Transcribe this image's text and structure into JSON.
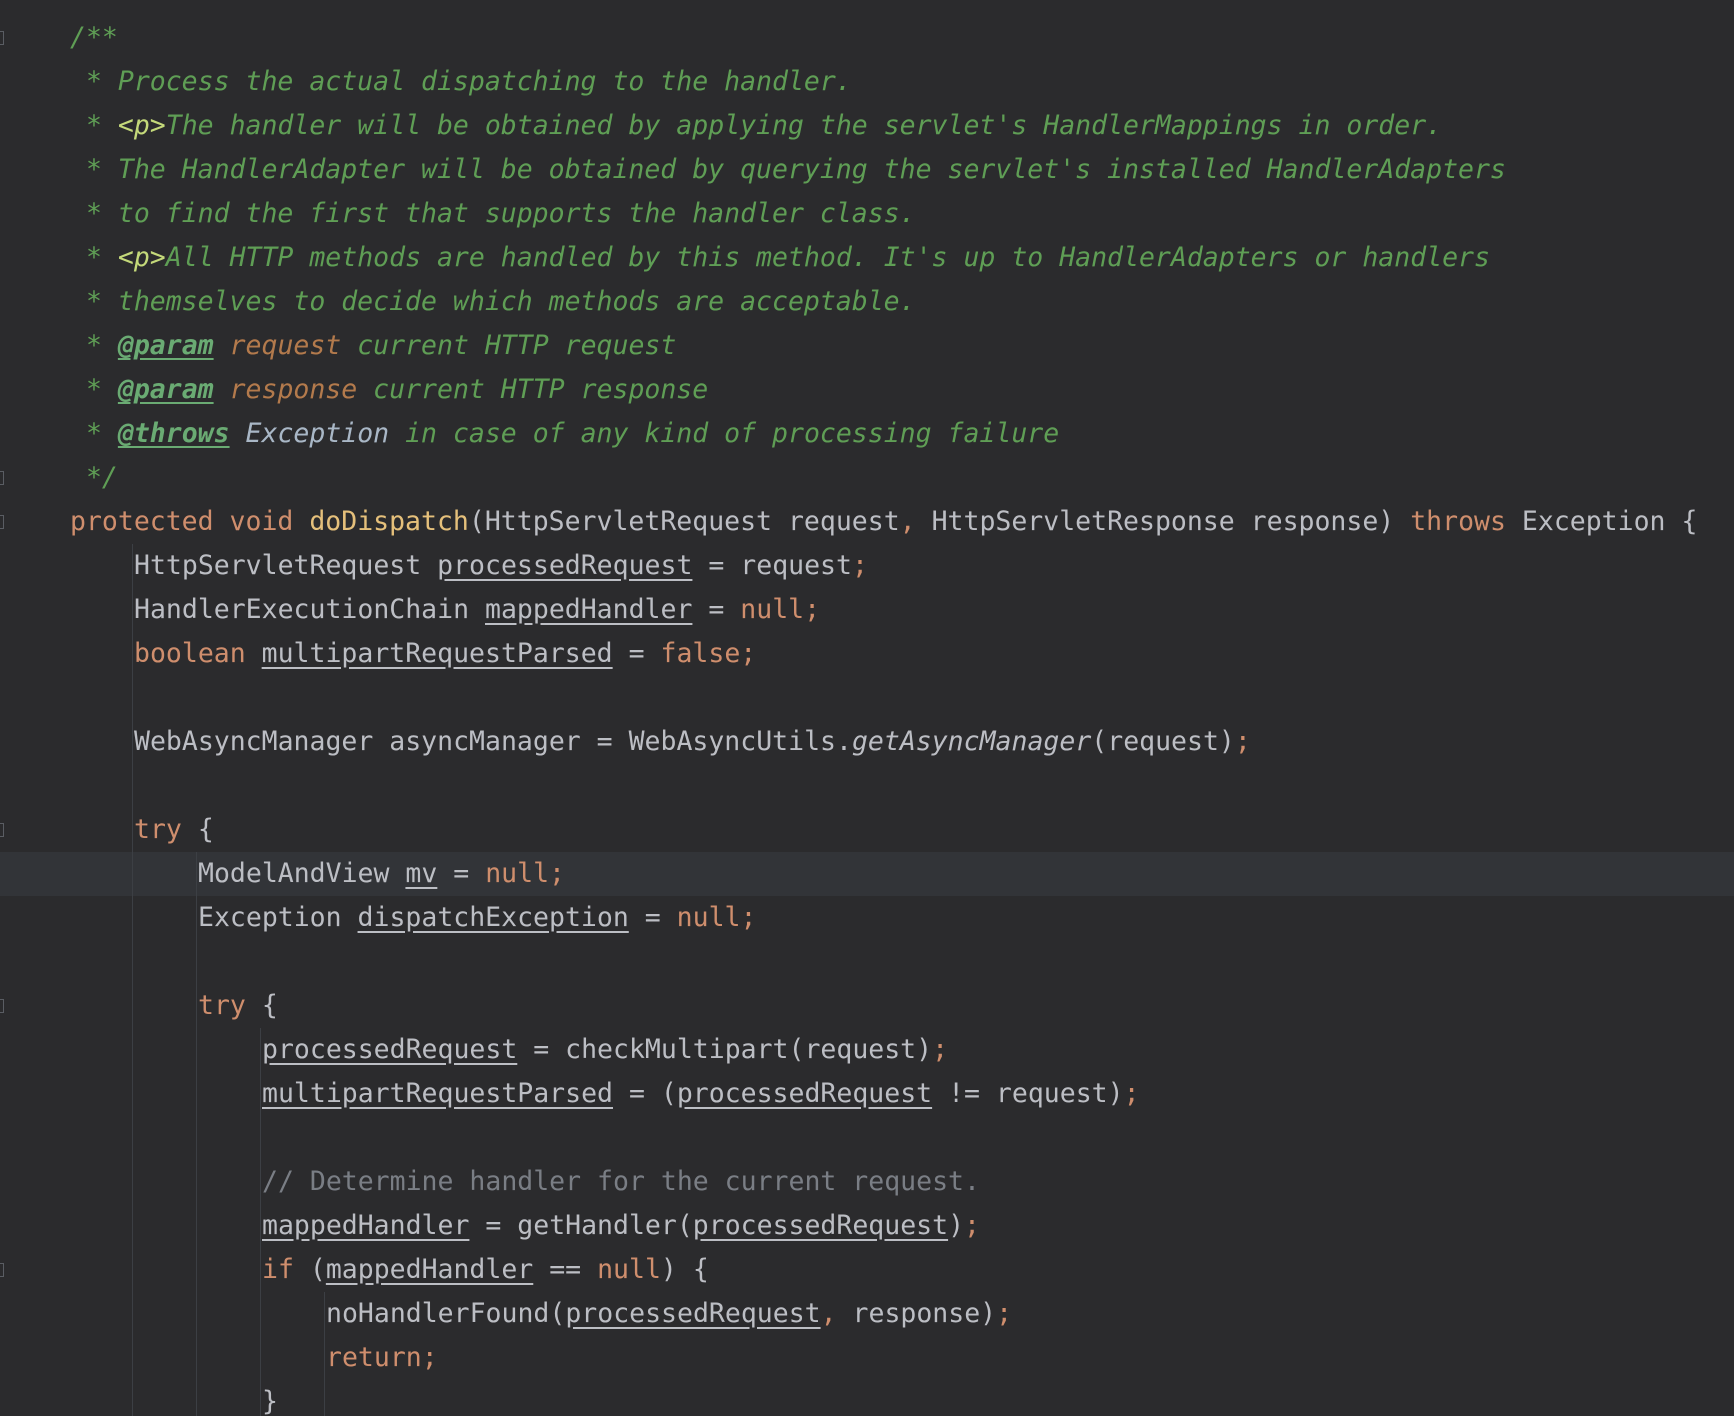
{
  "editor": {
    "language": "Java",
    "caret_line_index": 19,
    "colors": {
      "background": "#2b2b2d",
      "comment": "#5f9e55",
      "keyword": "#cf8e6d",
      "method_declaration": "#e5c07b",
      "identifier": "#bcbec4",
      "line_comment": "#7a7e85",
      "caret_row": "#323438"
    },
    "lines": [
      {
        "indent": 0,
        "tokens": [
          {
            "t": "/**",
            "c": "cm"
          }
        ]
      },
      {
        "indent": 0,
        "tokens": [
          {
            "t": " * Process the actual dispatching to the handler.",
            "c": "cm"
          }
        ]
      },
      {
        "indent": 0,
        "tokens": [
          {
            "t": " * ",
            "c": "cm"
          },
          {
            "t": "<p>",
            "c": "tag"
          },
          {
            "t": "The handler will be obtained by applying the servlet's HandlerMappings in order.",
            "c": "cm"
          }
        ]
      },
      {
        "indent": 0,
        "tokens": [
          {
            "t": " * The HandlerAdapter will be obtained by querying the servlet's installed HandlerAdapters",
            "c": "cm"
          }
        ]
      },
      {
        "indent": 0,
        "tokens": [
          {
            "t": " * to find the first that supports the handler class.",
            "c": "cm"
          }
        ]
      },
      {
        "indent": 0,
        "tokens": [
          {
            "t": " * ",
            "c": "cm"
          },
          {
            "t": "<p>",
            "c": "tag"
          },
          {
            "t": "All HTTP methods are handled by this method. It's up to HandlerAdapters or handlers",
            "c": "cm"
          }
        ]
      },
      {
        "indent": 0,
        "tokens": [
          {
            "t": " * themselves to decide which methods are acceptable.",
            "c": "cm"
          }
        ]
      },
      {
        "indent": 0,
        "tokens": [
          {
            "t": " * ",
            "c": "cm"
          },
          {
            "t": "@param",
            "c": "jtag"
          },
          {
            "t": " ",
            "c": "cm"
          },
          {
            "t": "request",
            "c": "prm"
          },
          {
            "t": " current HTTP request",
            "c": "cm"
          }
        ]
      },
      {
        "indent": 0,
        "tokens": [
          {
            "t": " * ",
            "c": "cm"
          },
          {
            "t": "@param",
            "c": "jtag"
          },
          {
            "t": " ",
            "c": "cm"
          },
          {
            "t": "response",
            "c": "prm"
          },
          {
            "t": " current HTTP response",
            "c": "cm"
          }
        ]
      },
      {
        "indent": 0,
        "tokens": [
          {
            "t": " * ",
            "c": "cm"
          },
          {
            "t": "@throws",
            "c": "jtag"
          },
          {
            "t": " ",
            "c": "cm"
          },
          {
            "t": "Exception",
            "c": "ref"
          },
          {
            "t": " in case of any kind of processing failure",
            "c": "cm"
          }
        ]
      },
      {
        "indent": 0,
        "tokens": [
          {
            "t": " */",
            "c": "cm"
          }
        ]
      },
      {
        "indent": 0,
        "tokens": [
          {
            "t": "protected void ",
            "c": "kw"
          },
          {
            "t": "doDispatch",
            "c": "fn"
          },
          {
            "t": "(HttpServletRequest request",
            "c": "id"
          },
          {
            "t": ", ",
            "c": "punc"
          },
          {
            "t": "HttpServletResponse response) ",
            "c": "id"
          },
          {
            "t": "throws ",
            "c": "kw"
          },
          {
            "t": "Exception {",
            "c": "id"
          }
        ]
      },
      {
        "indent": 1,
        "tokens": [
          {
            "t": "HttpServletRequest ",
            "c": "id"
          },
          {
            "t": "processedRequest",
            "c": "var"
          },
          {
            "t": " = request",
            "c": "id"
          },
          {
            "t": ";",
            "c": "punc"
          }
        ]
      },
      {
        "indent": 1,
        "tokens": [
          {
            "t": "HandlerExecutionChain ",
            "c": "id"
          },
          {
            "t": "mappedHandler",
            "c": "var"
          },
          {
            "t": " = ",
            "c": "id"
          },
          {
            "t": "null;",
            "c": "kw"
          }
        ]
      },
      {
        "indent": 1,
        "tokens": [
          {
            "t": "boolean ",
            "c": "kw"
          },
          {
            "t": "multipartRequestParsed",
            "c": "var"
          },
          {
            "t": " = ",
            "c": "id"
          },
          {
            "t": "false;",
            "c": "kw"
          }
        ]
      },
      {
        "indent": 1,
        "tokens": []
      },
      {
        "indent": 1,
        "tokens": [
          {
            "t": "WebAsyncManager asyncManager = WebAsyncUtils.",
            "c": "id"
          },
          {
            "t": "getAsyncManager",
            "c": "it"
          },
          {
            "t": "(request)",
            "c": "id"
          },
          {
            "t": ";",
            "c": "punc"
          }
        ]
      },
      {
        "indent": 1,
        "tokens": []
      },
      {
        "indent": 1,
        "tokens": [
          {
            "t": "try ",
            "c": "kw"
          },
          {
            "t": "{",
            "c": "id"
          }
        ]
      },
      {
        "indent": 2,
        "tokens": [
          {
            "t": "ModelAndView ",
            "c": "id"
          },
          {
            "t": "mv",
            "c": "var"
          },
          {
            "t": " = ",
            "c": "id"
          },
          {
            "t": "null;",
            "c": "kw"
          }
        ]
      },
      {
        "indent": 2,
        "tokens": [
          {
            "t": "Exception ",
            "c": "id"
          },
          {
            "t": "dispatchException",
            "c": "var"
          },
          {
            "t": " = ",
            "c": "id"
          },
          {
            "t": "null;",
            "c": "kw"
          }
        ]
      },
      {
        "indent": 2,
        "tokens": []
      },
      {
        "indent": 2,
        "tokens": [
          {
            "t": "try ",
            "c": "kw"
          },
          {
            "t": "{",
            "c": "id"
          }
        ]
      },
      {
        "indent": 3,
        "tokens": [
          {
            "t": "processedRequest",
            "c": "var"
          },
          {
            "t": " = checkMultipart(request)",
            "c": "id"
          },
          {
            "t": ";",
            "c": "punc"
          }
        ]
      },
      {
        "indent": 3,
        "tokens": [
          {
            "t": "multipartRequestParsed",
            "c": "var"
          },
          {
            "t": " = (",
            "c": "id"
          },
          {
            "t": "processedRequest",
            "c": "var"
          },
          {
            "t": " != request)",
            "c": "id"
          },
          {
            "t": ";",
            "c": "punc"
          }
        ]
      },
      {
        "indent": 3,
        "tokens": []
      },
      {
        "indent": 3,
        "tokens": [
          {
            "t": "// Determine handler for the current request.",
            "c": "lc"
          }
        ]
      },
      {
        "indent": 3,
        "tokens": [
          {
            "t": "mappedHandler",
            "c": "var"
          },
          {
            "t": " = getHandler(",
            "c": "id"
          },
          {
            "t": "processedRequest",
            "c": "var"
          },
          {
            "t": ")",
            "c": "id"
          },
          {
            "t": ";",
            "c": "punc"
          }
        ]
      },
      {
        "indent": 3,
        "tokens": [
          {
            "t": "if ",
            "c": "kw"
          },
          {
            "t": "(",
            "c": "id"
          },
          {
            "t": "mappedHandler",
            "c": "var"
          },
          {
            "t": " == ",
            "c": "id"
          },
          {
            "t": "null",
            "c": "kw"
          },
          {
            "t": ") {",
            "c": "id"
          }
        ]
      },
      {
        "indent": 4,
        "tokens": [
          {
            "t": "noHandlerFound(",
            "c": "id"
          },
          {
            "t": "processedRequest",
            "c": "var"
          },
          {
            "t": ", ",
            "c": "punc"
          },
          {
            "t": "response)",
            "c": "id"
          },
          {
            "t": ";",
            "c": "punc"
          }
        ]
      },
      {
        "indent": 4,
        "tokens": [
          {
            "t": "return;",
            "c": "kw"
          }
        ]
      },
      {
        "indent": 3,
        "tokens": [
          {
            "t": "}",
            "c": "id"
          }
        ]
      }
    ]
  }
}
